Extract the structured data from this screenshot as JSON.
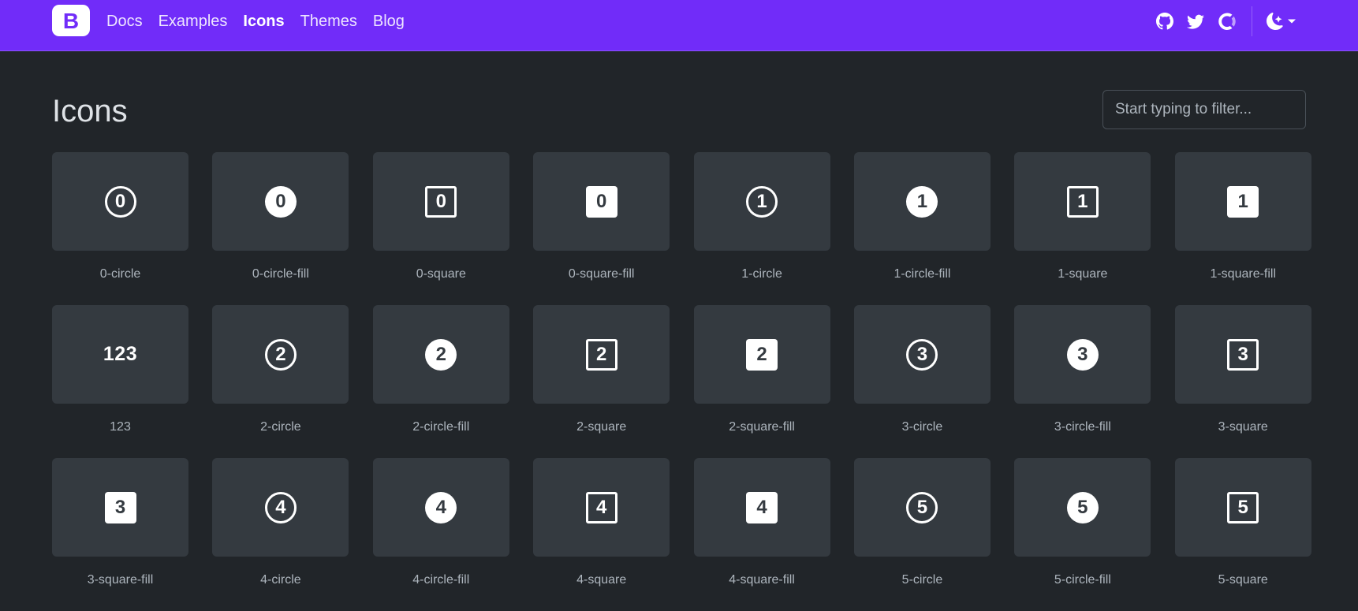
{
  "nav": {
    "brand_letter": "B",
    "links": [
      {
        "label": "Docs",
        "active": false
      },
      {
        "label": "Examples",
        "active": false
      },
      {
        "label": "Icons",
        "active": true
      },
      {
        "label": "Themes",
        "active": false
      },
      {
        "label": "Blog",
        "active": false
      }
    ],
    "icons": [
      "github-icon",
      "twitter-icon",
      "opencollective-icon"
    ],
    "theme_toggle_icon": "moon-stars-icon",
    "brand_color": "#712cf9"
  },
  "page": {
    "title": "Icons",
    "filter_placeholder": "Start typing to filter...",
    "filter_value": ""
  },
  "icons": [
    {
      "name": "0-circle",
      "glyph": "0",
      "style": "circle"
    },
    {
      "name": "0-circle-fill",
      "glyph": "0",
      "style": "circle-fill"
    },
    {
      "name": "0-square",
      "glyph": "0",
      "style": "square"
    },
    {
      "name": "0-square-fill",
      "glyph": "0",
      "style": "square-fill"
    },
    {
      "name": "1-circle",
      "glyph": "1",
      "style": "circle"
    },
    {
      "name": "1-circle-fill",
      "glyph": "1",
      "style": "circle-fill"
    },
    {
      "name": "1-square",
      "glyph": "1",
      "style": "square"
    },
    {
      "name": "1-square-fill",
      "glyph": "1",
      "style": "square-fill"
    },
    {
      "name": "123",
      "glyph": "123",
      "style": "text"
    },
    {
      "name": "2-circle",
      "glyph": "2",
      "style": "circle"
    },
    {
      "name": "2-circle-fill",
      "glyph": "2",
      "style": "circle-fill"
    },
    {
      "name": "2-square",
      "glyph": "2",
      "style": "square"
    },
    {
      "name": "2-square-fill",
      "glyph": "2",
      "style": "square-fill"
    },
    {
      "name": "3-circle",
      "glyph": "3",
      "style": "circle"
    },
    {
      "name": "3-circle-fill",
      "glyph": "3",
      "style": "circle-fill"
    },
    {
      "name": "3-square",
      "glyph": "3",
      "style": "square"
    },
    {
      "name": "3-square-fill",
      "glyph": "3",
      "style": "square-fill"
    },
    {
      "name": "4-circle",
      "glyph": "4",
      "style": "circle"
    },
    {
      "name": "4-circle-fill",
      "glyph": "4",
      "style": "circle-fill"
    },
    {
      "name": "4-square",
      "glyph": "4",
      "style": "square"
    },
    {
      "name": "4-square-fill",
      "glyph": "4",
      "style": "square-fill"
    },
    {
      "name": "5-circle",
      "glyph": "5",
      "style": "circle"
    },
    {
      "name": "5-circle-fill",
      "glyph": "5",
      "style": "circle-fill"
    },
    {
      "name": "5-square",
      "glyph": "5",
      "style": "square"
    }
  ]
}
